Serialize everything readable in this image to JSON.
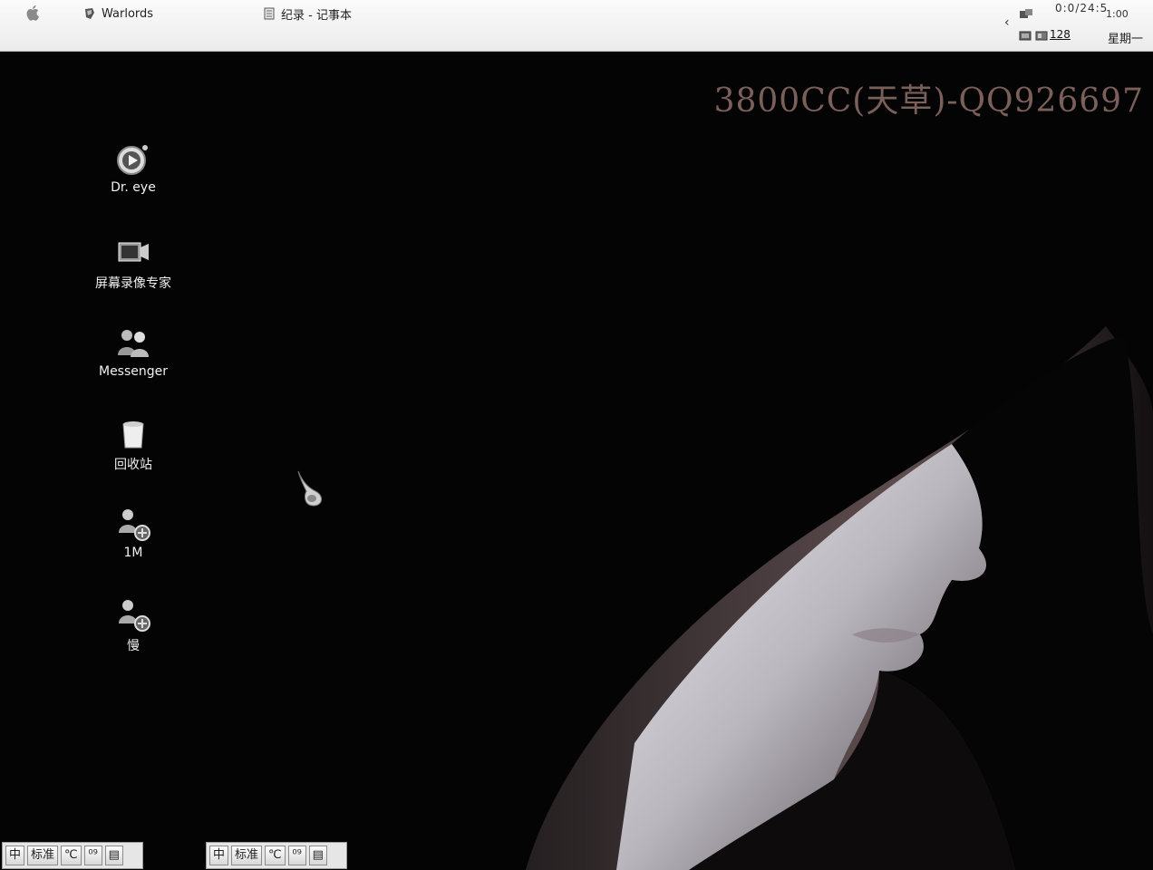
{
  "menubar": {
    "tasks": [
      {
        "label": "Warlords"
      },
      {
        "label": "纪录 - 记事本"
      }
    ],
    "tray": {
      "clock_top": "0:0/24:5",
      "clock_small": "1:00",
      "badge": "128",
      "weekday": "星期一"
    }
  },
  "watermark": "3800CC(天草)-QQ926697",
  "desktop_icons": [
    {
      "label": "Dr. eye",
      "icon": "play-disc-icon"
    },
    {
      "label": "屏幕录像专家",
      "icon": "screen-recorder-icon"
    },
    {
      "label": "Messenger",
      "icon": "messenger-people-icon"
    },
    {
      "label": "回收站",
      "icon": "recycle-bin-icon"
    },
    {
      "label": "1M",
      "icon": "network-people-icon"
    },
    {
      "label": "慢",
      "icon": "network-people-icon"
    }
  ],
  "ime_bars": [
    {
      "buttons": [
        "中",
        "标准",
        "℃",
        "⁰⁹",
        "▤"
      ]
    },
    {
      "buttons": [
        "中",
        "标准",
        "℃",
        "⁰⁹",
        "▤"
      ]
    }
  ],
  "colors": {
    "desktop_bg": "#040404",
    "watermark": "#7a5f5a",
    "menubar": "#f2f2f2"
  }
}
